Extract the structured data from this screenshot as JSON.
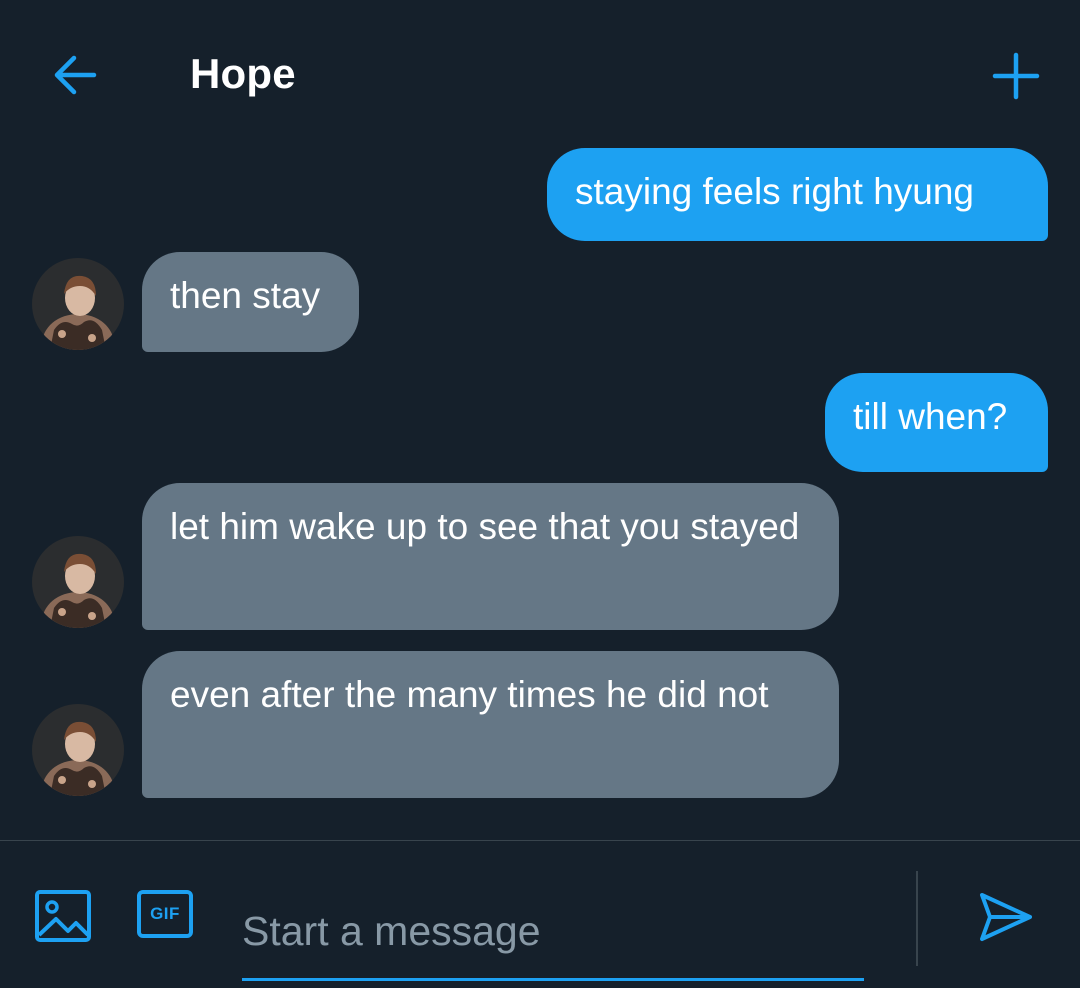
{
  "header": {
    "title": "Hope",
    "back_icon": "arrow-left-icon",
    "new_icon": "plus-icon"
  },
  "messages": [
    {
      "direction": "sent",
      "text": "staying feels right hyung"
    },
    {
      "direction": "received",
      "text": "then stay"
    },
    {
      "direction": "sent",
      "text": "till when?"
    },
    {
      "direction": "received",
      "text": "let him wake up to see that you stayed"
    },
    {
      "direction": "received",
      "text": "even after the many times he did not"
    }
  ],
  "composer": {
    "placeholder": "Start a message",
    "gif_label": "GIF",
    "image_icon": "image-icon",
    "send_icon": "send-icon"
  },
  "colors": {
    "background": "#15202b",
    "accent": "#1da1f2",
    "received_bubble": "#657786",
    "placeholder": "#8899a6",
    "divider": "#38444d"
  }
}
